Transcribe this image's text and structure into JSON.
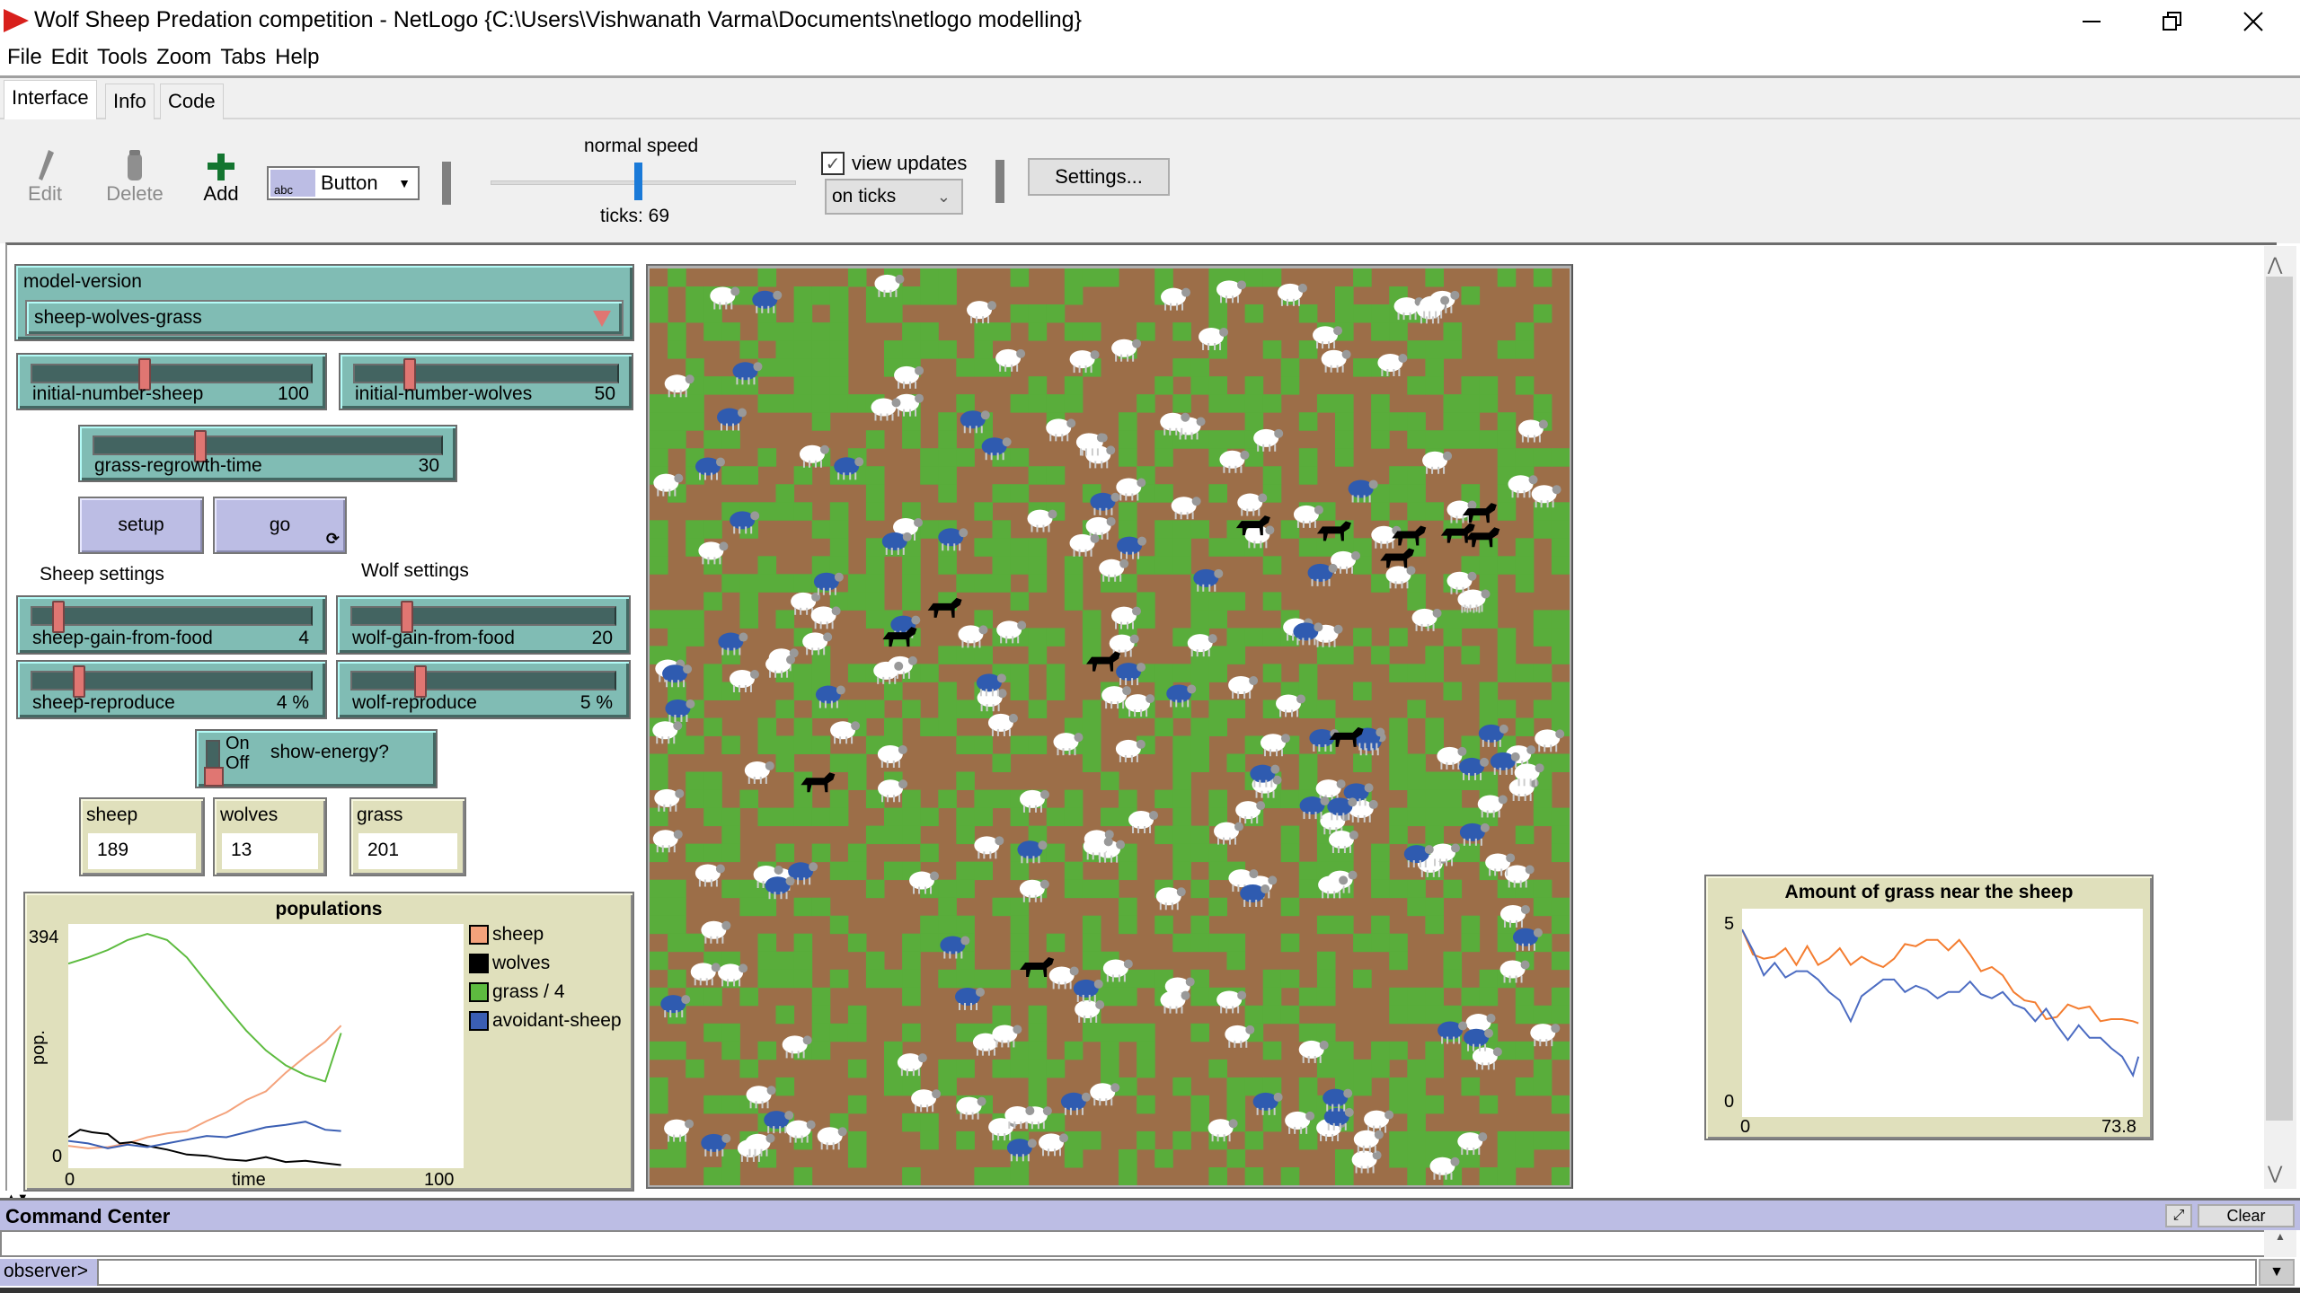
{
  "window": {
    "title": "Wolf Sheep Predation competition - NetLogo {C:\\Users\\Vishwanath Varma\\Documents\\netlogo modelling}",
    "minimize_icon": "minimize-icon",
    "maximize_icon": "restore-icon",
    "close_icon": "close-icon"
  },
  "menu": [
    "File",
    "Edit",
    "Tools",
    "Zoom",
    "Tabs",
    "Help"
  ],
  "tabs": [
    {
      "label": "Interface",
      "active": true
    },
    {
      "label": "Info",
      "active": false
    },
    {
      "label": "Code",
      "active": false
    }
  ],
  "toolbar": {
    "edit_label": "Edit",
    "delete_label": "Delete",
    "add_label": "Add",
    "widget_type": "Button",
    "widget_type_icon": "abc",
    "speed_label": "normal speed",
    "speed_fraction": 0.5,
    "ticks_label": "ticks: 69",
    "view_updates_label": "view updates",
    "view_updates_checked": true,
    "update_mode": "on ticks",
    "settings_label": "Settings..."
  },
  "widgets": {
    "chooser": {
      "label": "model-version",
      "value": "sheep-wolves-grass"
    },
    "sliders": {
      "initial_number_sheep": {
        "name": "initial-number-sheep",
        "display": "100",
        "value": 100,
        "min": 0,
        "max": 250
      },
      "initial_number_wolves": {
        "name": "initial-number-wolves",
        "display": "50",
        "value": 50,
        "min": 0,
        "max": 250
      },
      "grass_regrowth_time": {
        "name": "grass-regrowth-time",
        "display": "30",
        "value": 30,
        "min": 0,
        "max": 100
      },
      "sheep_gain_from_food": {
        "name": "sheep-gain-from-food",
        "display": "4",
        "value": 4,
        "min": 0,
        "max": 50
      },
      "wolf_gain_from_food": {
        "name": "wolf-gain-from-food",
        "display": "20",
        "value": 20,
        "min": 0,
        "max": 100
      },
      "sheep_reproduce": {
        "name": "sheep-reproduce",
        "display": "4 %",
        "value": 4,
        "min": 1,
        "max": 20
      },
      "wolf_reproduce": {
        "name": "wolf-reproduce",
        "display": "5 %",
        "value": 5,
        "min": 0,
        "max": 20
      }
    },
    "buttons": {
      "setup": "setup",
      "go": "go"
    },
    "notes": {
      "sheep_settings": "Sheep settings",
      "wolf_settings": "Wolf settings"
    },
    "switch": {
      "label": "show-energy?",
      "on_text": "On",
      "off_text": "Off",
      "state": "off"
    },
    "monitors": [
      {
        "label": "sheep",
        "value": "189"
      },
      {
        "label": "wolves",
        "value": "13"
      },
      {
        "label": "grass",
        "value": "201"
      }
    ]
  },
  "world": {
    "patch_cols": 51,
    "patch_rows": 51,
    "grass_color": "#59ad3b",
    "dirt_color": "#9c6e48",
    "sheep_color": "#ffffff",
    "avoidant_sheep_color": "#2f5bb0",
    "wolf_color": "#000000"
  },
  "command_center": {
    "title": "Command Center",
    "clear_label": "Clear",
    "observer_label": "observer>",
    "input_value": ""
  },
  "chart_data": [
    {
      "type": "line",
      "title": "populations",
      "xlabel": "time",
      "ylabel": "pop.",
      "xlim": [
        0,
        100
      ],
      "ylim": [
        0,
        394
      ],
      "x_tick_labels": [
        "0",
        "100"
      ],
      "y_tick_labels": [
        "0",
        "394"
      ],
      "legend": "right",
      "series": [
        {
          "name": "sheep",
          "color": "#f4a27b",
          "x": [
            0,
            5,
            10,
            15,
            20,
            25,
            30,
            35,
            40,
            45,
            50,
            55,
            60,
            65,
            69
          ],
          "y": [
            36,
            32,
            34,
            40,
            50,
            56,
            60,
            76,
            90,
            110,
            124,
            154,
            180,
            204,
            230
          ]
        },
        {
          "name": "wolves",
          "color": "#000000",
          "x": [
            0,
            3,
            6,
            10,
            13,
            16,
            20,
            25,
            30,
            35,
            40,
            45,
            50,
            55,
            60,
            65,
            69
          ],
          "y": [
            50,
            62,
            58,
            55,
            40,
            42,
            36,
            30,
            22,
            20,
            14,
            12,
            18,
            10,
            12,
            8,
            5
          ]
        },
        {
          "name": "grass / 4",
          "color": "#5dbb3f",
          "x": [
            0,
            5,
            10,
            15,
            20,
            25,
            30,
            35,
            40,
            45,
            50,
            55,
            60,
            65,
            69
          ],
          "y": [
            330,
            340,
            352,
            368,
            378,
            368,
            340,
            300,
            260,
            222,
            190,
            166,
            150,
            140,
            218
          ]
        },
        {
          "name": "avoidant-sheep",
          "color": "#3a5eb3",
          "x": [
            0,
            5,
            10,
            15,
            20,
            25,
            30,
            35,
            40,
            45,
            50,
            55,
            60,
            65,
            69
          ],
          "y": [
            44,
            40,
            32,
            38,
            34,
            40,
            46,
            52,
            50,
            58,
            66,
            70,
            75,
            62,
            60
          ]
        }
      ]
    },
    {
      "type": "line",
      "title": "Amount of grass near the sheep",
      "xlabel": "",
      "ylabel": "",
      "xlim": [
        0,
        73.8
      ],
      "ylim": [
        0,
        5
      ],
      "x_tick_labels": [
        "0",
        "73.8"
      ],
      "y_tick_labels": [
        "0",
        "5"
      ],
      "legend": "none",
      "series": [
        {
          "name": "sheep",
          "color": "#f47d30",
          "x": [
            0,
            2,
            4,
            6,
            8,
            10,
            12,
            14,
            16,
            18,
            20,
            22,
            24,
            26,
            28,
            30,
            32,
            34,
            36,
            38,
            40,
            42,
            44,
            46,
            48,
            50,
            52,
            54,
            56,
            58,
            60,
            62,
            64,
            66,
            68,
            70,
            72,
            73
          ],
          "y": [
            4.5,
            3.9,
            3.8,
            3.85,
            4.05,
            3.65,
            4.1,
            3.65,
            3.8,
            4.05,
            3.65,
            3.85,
            3.7,
            3.6,
            3.8,
            4.15,
            4.1,
            4.25,
            4.25,
            4.0,
            4.25,
            3.9,
            3.5,
            3.6,
            3.4,
            3.0,
            2.8,
            2.75,
            2.35,
            2.4,
            2.7,
            2.6,
            2.65,
            2.3,
            2.35,
            2.35,
            2.3,
            2.25
          ]
        },
        {
          "name": "avoidant-sheep",
          "color": "#4c6cc2",
          "x": [
            0,
            2,
            4,
            6,
            8,
            10,
            12,
            14,
            16,
            18,
            20,
            22,
            24,
            26,
            28,
            30,
            32,
            34,
            36,
            38,
            40,
            42,
            44,
            46,
            48,
            50,
            52,
            54,
            56,
            58,
            60,
            62,
            64,
            66,
            68,
            70,
            72,
            73
          ],
          "y": [
            4.5,
            4.0,
            3.4,
            3.7,
            3.35,
            3.5,
            3.5,
            3.3,
            3.0,
            2.8,
            2.3,
            2.9,
            3.1,
            3.3,
            3.3,
            3.0,
            3.15,
            3.05,
            2.85,
            3.0,
            3.0,
            3.25,
            2.95,
            2.85,
            3.0,
            2.7,
            2.6,
            2.3,
            2.6,
            2.2,
            1.85,
            2.2,
            1.9,
            1.9,
            1.65,
            1.45,
            1.0,
            1.45
          ]
        }
      ]
    }
  ]
}
